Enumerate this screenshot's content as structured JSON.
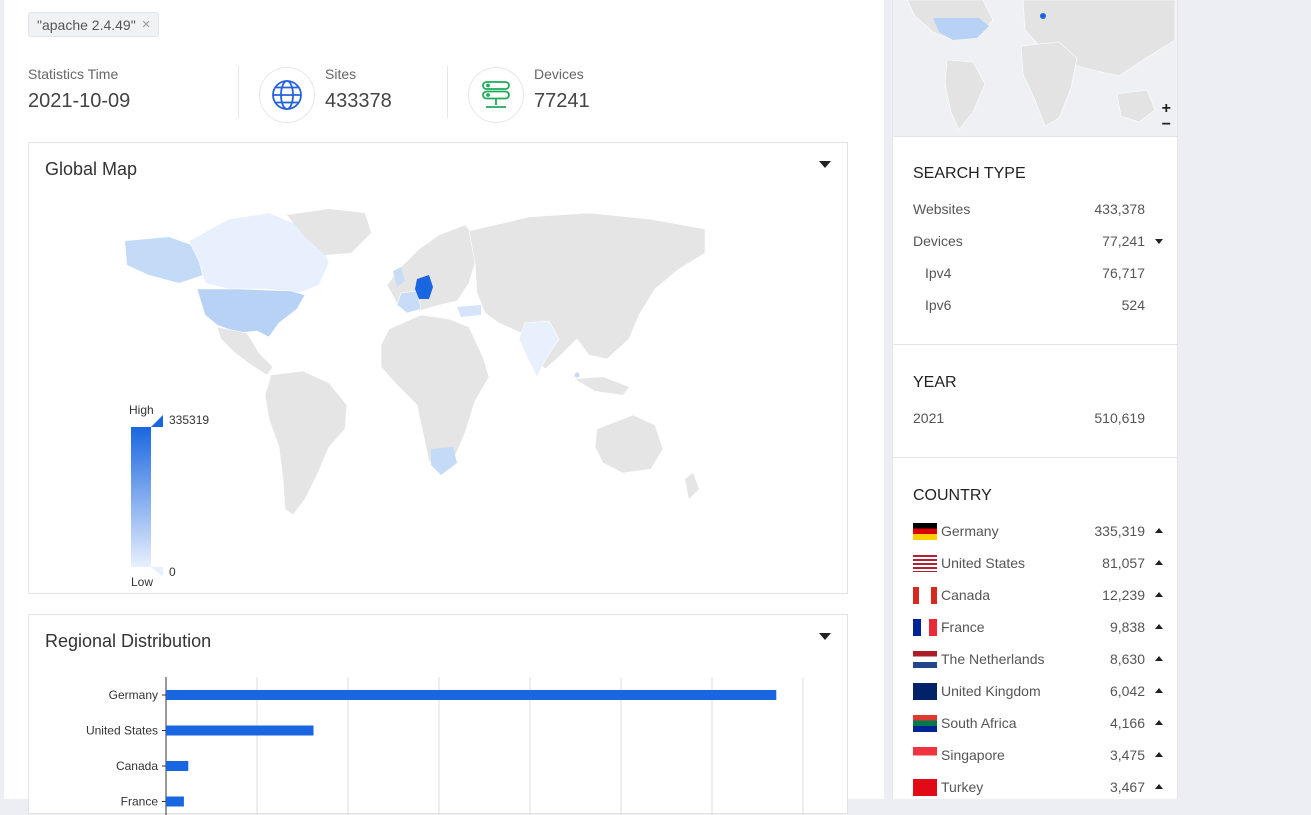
{
  "search": {
    "tag": "\"apache 2.4.49\""
  },
  "stats": {
    "time_label": "Statistics Time",
    "time_value": "2021-10-09",
    "sites_label": "Sites",
    "sites_value": "433378",
    "devices_label": "Devices",
    "devices_value": "77241"
  },
  "icons": {
    "sites": "globe-icon",
    "devices": "server-icon"
  },
  "global_map": {
    "title": "Global Map",
    "legend": {
      "high_label": "High",
      "low_label": "Low",
      "max": "335319",
      "min": "0"
    },
    "colors": {
      "high": "#1a66e0",
      "low": "#e8f0fd",
      "land": "#e5e5e5"
    }
  },
  "regional": {
    "title": "Regional Distribution"
  },
  "chart_data": {
    "type": "bar",
    "orientation": "horizontal",
    "categories": [
      "Germany",
      "United States",
      "Canada",
      "France"
    ],
    "values": [
      335319,
      81057,
      12239,
      9838
    ],
    "xlim": [
      0,
      350000
    ],
    "grid": true,
    "color": "#1a66e0"
  },
  "sidebar": {
    "search_type": {
      "title": "SEARCH TYPE",
      "items": [
        {
          "name": "Websites",
          "value": "433,378"
        },
        {
          "name": "Devices",
          "value": "77,241"
        },
        {
          "name": "Ipv4",
          "value": "76,717"
        },
        {
          "name": "Ipv6",
          "value": "524"
        }
      ]
    },
    "year": {
      "title": "YEAR",
      "items": [
        {
          "name": "2021",
          "value": "510,619"
        }
      ]
    },
    "country": {
      "title": "COUNTRY",
      "items": [
        {
          "name": "Germany",
          "value": "335,319"
        },
        {
          "name": "United States",
          "value": "81,057"
        },
        {
          "name": "Canada",
          "value": "12,239"
        },
        {
          "name": "France",
          "value": "9,838"
        },
        {
          "name": "The Netherlands",
          "value": "8,630"
        },
        {
          "name": "United Kingdom",
          "value": "6,042"
        },
        {
          "name": "South Africa",
          "value": "4,166"
        },
        {
          "name": "Singapore",
          "value": "3,475"
        },
        {
          "name": "Turkey",
          "value": "3,467"
        }
      ]
    },
    "zoom": {
      "in": "+",
      "out": "−"
    }
  }
}
